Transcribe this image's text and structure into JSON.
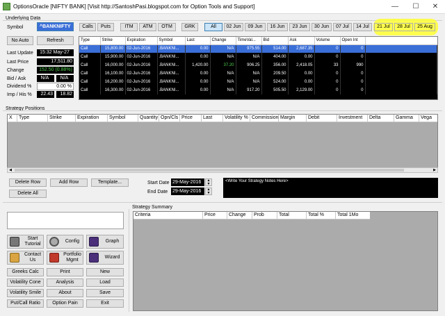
{
  "window": {
    "title": "OptionsOracle [NIFTY BANK]    [Visit  http://SantoshPasi.blogspot.com  for Option Tools and Support]",
    "minimize": "—",
    "maximize": "☐",
    "close": "✕"
  },
  "underlying": {
    "section_label": "Underlying Data",
    "symbol_label": "Symbol",
    "symbol_value": "^BANKNIFTY",
    "no_auto": "No Auto",
    "refresh": "Refresh",
    "rows": [
      {
        "label": "Last Update",
        "value": "15:32 May-27"
      },
      {
        "label": "Last Price",
        "value": "17,511.80"
      },
      {
        "label": "Change",
        "value": "152.50 (0.88%)"
      },
      {
        "label": "Bid / Ask",
        "value1": "N/A",
        "value2": "N/A"
      },
      {
        "label": "Dividend %",
        "value": "0.00 %"
      },
      {
        "label": "Imp / His %",
        "value1": "22.43",
        "value2": "18.82"
      }
    ]
  },
  "filters": {
    "calls": "Calls",
    "puts": "Puts",
    "itm": "ITM",
    "atm": "ATM",
    "otm": "OTM",
    "grk": "GRK",
    "dates": [
      "All",
      "02 Jun",
      "09 Jun",
      "16 Jun",
      "23 Jun",
      "30 Jun",
      "07 Jul",
      "14 Jul",
      "21 Jul",
      "28 Jul",
      "25 Aug"
    ]
  },
  "option_table": {
    "headers": [
      "Type",
      "Strike",
      "Expiration",
      "Symbol",
      "Last",
      "Change",
      "TimeVal...",
      "Bid",
      "Ask",
      "Volume",
      "Open Int"
    ],
    "rows": [
      [
        "Call",
        "15,800.00",
        "02-Jun-2016",
        ".BANKNI...",
        "0.00",
        "N/A",
        "975.55",
        "514.00",
        "2,687.35",
        "0",
        "0"
      ],
      [
        "Call",
        "15,900.00",
        "02-Jun-2016",
        ".BANKNI...",
        "0.00",
        "N/A",
        "N/A",
        "404.00",
        "0.00",
        "0",
        "0"
      ],
      [
        "Call",
        "16,000.00",
        "02-Jun-2016",
        ".BANKNI...",
        "1,420.00",
        "37.20",
        "906.25",
        "356.00",
        "2,418.05",
        "33",
        "990"
      ],
      [
        "Call",
        "16,100.00",
        "02-Jun-2016",
        ".BANKNI...",
        "0.00",
        "N/A",
        "N/A",
        "209.50",
        "0.00",
        "0",
        "0"
      ],
      [
        "Call",
        "16,200.00",
        "02-Jun-2016",
        ".BANKNI...",
        "0.00",
        "N/A",
        "N/A",
        "524.00",
        "0.00",
        "0",
        "0"
      ],
      [
        "Call",
        "16,300.00",
        "02-Jun-2016",
        ".BANKNI...",
        "0.00",
        "N/A",
        "917.20",
        "505.50",
        "2,129.00",
        "0",
        "0"
      ]
    ]
  },
  "strategy_positions": {
    "section_label": "Strategy Positions",
    "headers": [
      "X",
      "Type",
      "Strike",
      "Expiration",
      "Symbol",
      "Quantity",
      "Opn/Cls",
      "Price",
      "Last",
      "Volatility %",
      "Commission",
      "Margin",
      "Debit",
      "Investment",
      "Delta",
      "Gamma",
      "Vega"
    ],
    "delete_row": "Delete Row",
    "add_row": "Add Row",
    "template": "Template...",
    "delete_all": "Delete All",
    "start_date_label": "Start Date",
    "start_date": "29-May-2016",
    "end_date_label": "End Date",
    "end_date": "29-May-2016",
    "notes": "<Write Your Strategy Notes Here>"
  },
  "tools": {
    "start_tutorial": "Start Tutorial",
    "config": "Config",
    "graph": "Graph",
    "contact_us": "Contact Us",
    "portfolio_mgmt": "Portfolio Mgmt",
    "wizard": "Wizard",
    "small": [
      "Greeks Calc",
      "Print",
      "New",
      "Volatility Cone",
      "Analysis",
      "Load",
      "Volatility Smile",
      "About",
      "Save",
      "Put/Call Ratio",
      "Option Pain",
      "Exit"
    ]
  },
  "strategy_summary": {
    "section_label": "Strategy Summary",
    "headers": [
      "Criteria",
      "Price",
      "Change",
      "Prob",
      "Total",
      "Total %",
      "Total 1Mo"
    ]
  },
  "colors": {
    "highlight": "#ffff33",
    "selected_row": "#3b6fd8",
    "grid_gray": "#ababab"
  }
}
